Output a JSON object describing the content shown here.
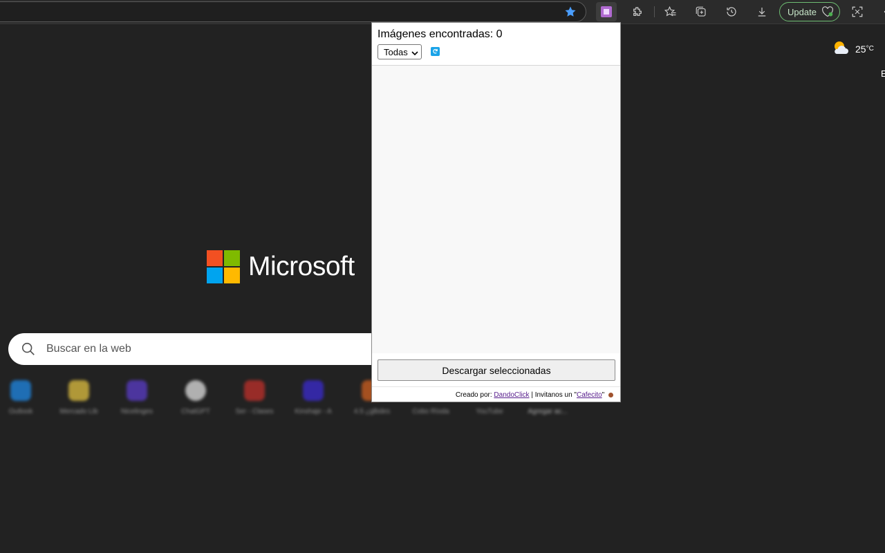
{
  "browser": {
    "update_label": "Update"
  },
  "weather": {
    "temperature": "25",
    "unit": "°C"
  },
  "edge_partial_text": "E",
  "newtab": {
    "brand": "Microsoft",
    "search_placeholder": "Buscar en la web",
    "shortcuts": [
      {
        "label": "Outlook",
        "color": "#1e88e5"
      },
      {
        "label": "Mercado Lib",
        "color": "#e0c040"
      },
      {
        "label": "Nicelinges",
        "color": "#5a3cc8"
      },
      {
        "label": "ChatGPT",
        "color": "#e0e0e0"
      },
      {
        "label": "Ser - Clases",
        "color": "#c0302a"
      },
      {
        "label": "Kinshaje - A",
        "color": "#3a2ad0"
      },
      {
        "label": "4.5 ¿glbdes",
        "color": "#d06020"
      },
      {
        "label": "Cobo Ríoda",
        "color": "#444444"
      },
      {
        "label": "YouTube",
        "color": "#333333"
      },
      {
        "label": "Agregar ac...",
        "color": "#2a2a2a"
      }
    ]
  },
  "popup": {
    "title_prefix": "Imágenes encontradas:",
    "count": "0",
    "filter_selected": "Todas",
    "download_button": "Descargar seleccionadas",
    "footer_prefix": "Creado por:",
    "footer_author": "DandoClick",
    "footer_middle": "| Invitanos un \"",
    "footer_link": "Cafecito",
    "footer_suffix": "\""
  },
  "colors": {
    "page_bg": "#222222",
    "accent_blue": "#1aa3e8",
    "update_green": "#6fbf73",
    "ms_red": "#f25022",
    "ms_green": "#7fba00",
    "ms_blue": "#00a4ef",
    "ms_yellow": "#ffb900"
  }
}
